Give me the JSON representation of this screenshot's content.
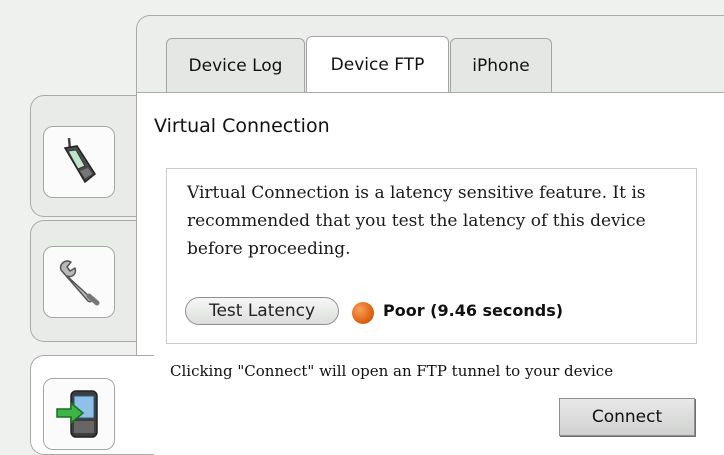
{
  "side_tabs": [
    {
      "icon": "mobile-phone-icon",
      "active": false
    },
    {
      "icon": "wrench-icon",
      "active": false
    },
    {
      "icon": "device-ftp-icon",
      "active": true
    }
  ],
  "tabs": [
    {
      "label": "Device Log"
    },
    {
      "label": "Device FTP",
      "active": true
    },
    {
      "label": "iPhone"
    }
  ],
  "section": {
    "title": "Virtual Connection"
  },
  "info": {
    "text": "Virtual Connection is a latency sensitive feature. It is recommended that you test the latency of this device before proceeding.",
    "test_button_label": "Test Latency",
    "status_color": "#e06314",
    "status_label": "Poor (9.46 seconds)"
  },
  "hint": "Clicking \"Connect\" will open an FTP tunnel to your device",
  "connect_button_label": "Connect"
}
